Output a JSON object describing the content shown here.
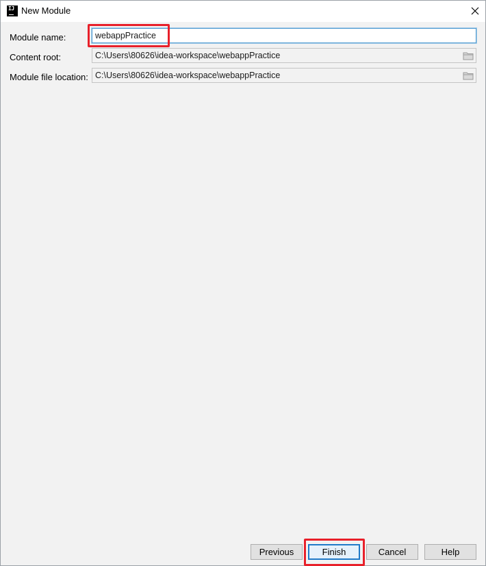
{
  "window": {
    "title": "New Module",
    "app_icon_text": "IJ"
  },
  "form": {
    "module_name": {
      "label": "Module name:",
      "value": "webappPractice"
    },
    "content_root": {
      "label": "Content root:",
      "value": "C:\\Users\\80626\\idea-workspace\\webappPractice"
    },
    "module_file_location": {
      "label": "Module file location:",
      "value": "C:\\Users\\80626\\idea-workspace\\webappPractice"
    }
  },
  "buttons": {
    "previous": "Previous",
    "finish": "Finish",
    "cancel": "Cancel",
    "help": "Help"
  },
  "colors": {
    "highlight": "#e8202a",
    "focus_border": "#4e9bd1",
    "default_button_border": "#1e7ac9"
  }
}
